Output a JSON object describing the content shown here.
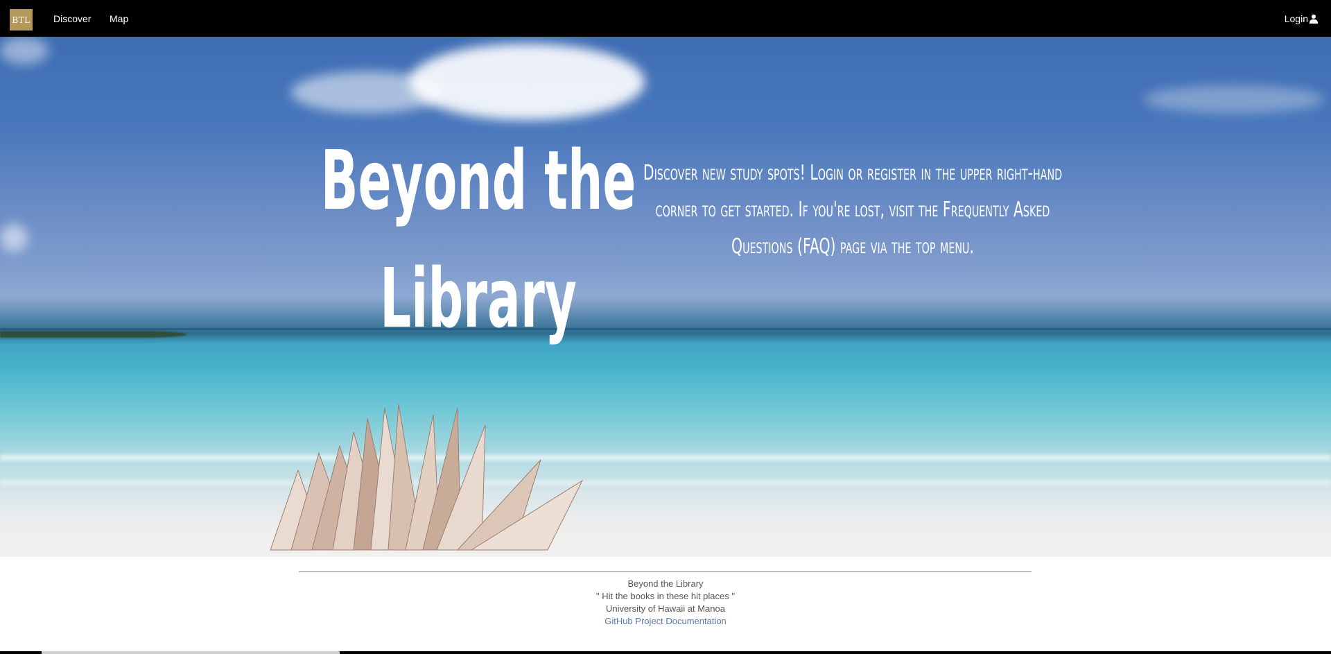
{
  "nav": {
    "logo_text": "BTL",
    "discover_label": "Discover",
    "map_label": "Map",
    "login_label": "Login"
  },
  "hero": {
    "title_line1": "Beyond the",
    "title_line2": "Library",
    "description": "Discover new study spots! Login or register in the upper right-hand corner to get started. If you're lost, visit the Frequently Asked Questions (FAQ) page via the top menu."
  },
  "footer": {
    "line1": "Beyond the Library",
    "line2": "\" Hit the books in these hit places \"",
    "line3": "University of Hawaii at Manoa",
    "link_label": "GitHub Project Documentation"
  },
  "colors": {
    "nav_bg": "#000000",
    "logo_bg": "#b4985a",
    "footer_link": "#5b7ab0"
  },
  "icons": {
    "login": "user-icon"
  }
}
